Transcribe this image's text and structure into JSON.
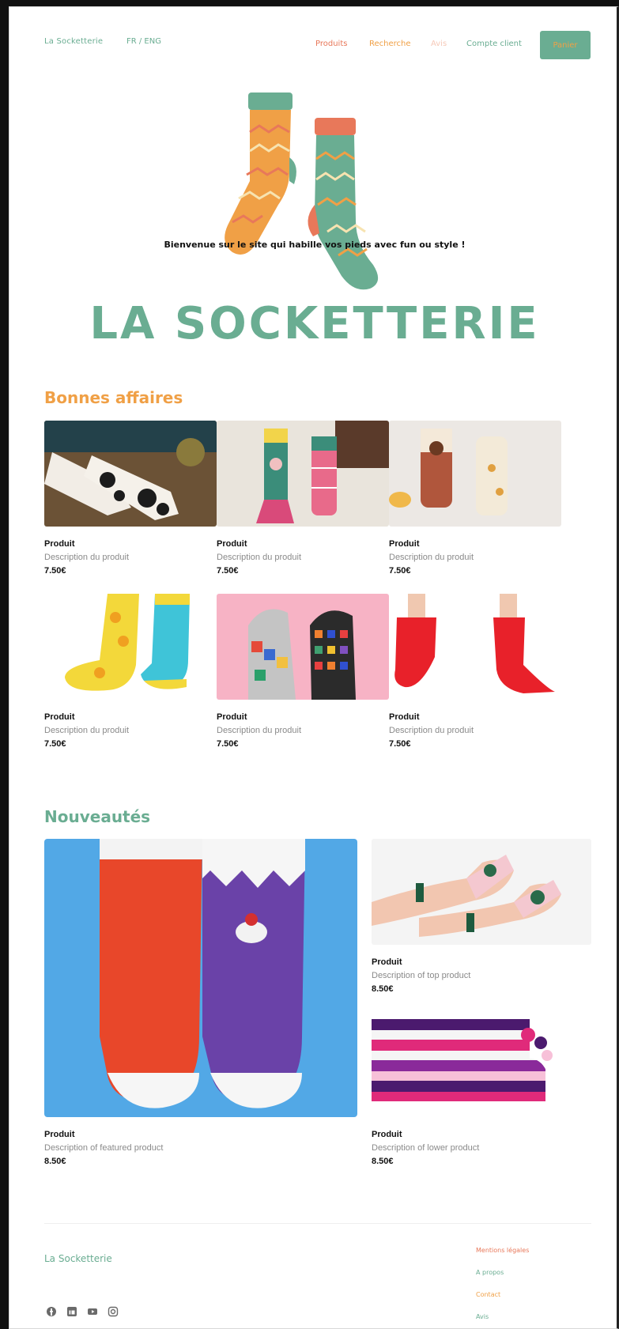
{
  "header": {
    "logo": "La Socketterie",
    "lang": "FR / ENG",
    "nav": {
      "produits": "Produits",
      "recherche": "Recherche",
      "avis": "Avis",
      "compte": "Compte client"
    },
    "cart_button": "Panier"
  },
  "hero": {
    "welcome": "Bienvenue sur le site qui habille vos pieds avec fun ou style !",
    "brand": "LA SOCKETTERIE"
  },
  "deals": {
    "title": "Bonnes affaires",
    "items": [
      {
        "name": "Produit",
        "desc": "Description du produit",
        "price": "7.50€"
      },
      {
        "name": "Produit",
        "desc": "Description du produit",
        "price": "7.50€"
      },
      {
        "name": "Produit",
        "desc": "Description du produit",
        "price": "7.50€"
      },
      {
        "name": "Produit",
        "desc": "Description du produit",
        "price": "7.50€"
      },
      {
        "name": "Produit",
        "desc": "Description du produit",
        "price": "7.50€"
      },
      {
        "name": "Produit",
        "desc": "Description du produit",
        "price": "7.50€"
      }
    ]
  },
  "new": {
    "title": "Nouveautés",
    "featured": {
      "name": "Produit",
      "desc": "Description of featured product",
      "price": "8.50€"
    },
    "top": {
      "name": "Produit",
      "desc": "Description of top product",
      "price": "8.50€"
    },
    "lower": {
      "name": "Produit",
      "desc": "Description of lower product",
      "price": "8.50€"
    }
  },
  "footer": {
    "brand": "La Socketterie",
    "links": [
      "Mentions légales",
      "A propos",
      "Contact",
      "Avis"
    ],
    "social_icons": [
      "facebook-icon",
      "linkedin-icon",
      "youtube-icon",
      "instagram-icon"
    ]
  },
  "colors": {
    "green": "#6aad92",
    "orange": "#f0a046",
    "coral": "#e8785a"
  }
}
